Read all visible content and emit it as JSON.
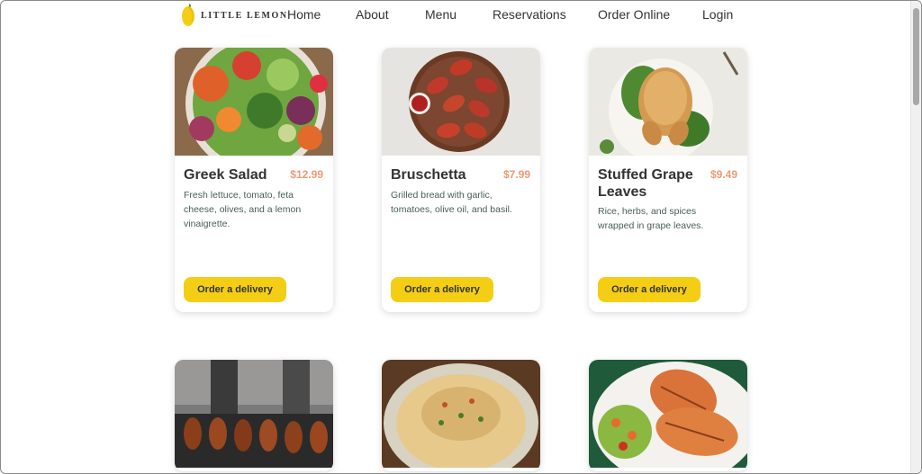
{
  "brand": {
    "name": "LITTLE LEMON"
  },
  "nav": {
    "items": [
      {
        "label": "Home"
      },
      {
        "label": "About"
      },
      {
        "label": "Menu"
      },
      {
        "label": "Reservations"
      },
      {
        "label": "Order Online"
      },
      {
        "label": "Login"
      }
    ]
  },
  "menu": {
    "cards": [
      {
        "title": "Greek Salad",
        "price": "$12.99",
        "description": "Fresh lettuce, tomato, feta cheese, olives, and a lemon vinaigrette.",
        "button": "Order a delivery",
        "image": "greek-salad-photo"
      },
      {
        "title": "Bruschetta",
        "price": "$7.99",
        "description": "Grilled bread with garlic, tomatoes, olive oil, and basil.",
        "button": "Order a delivery",
        "image": "bruschetta-photo"
      },
      {
        "title": "Stuffed Grape Leaves",
        "price": "$9.49",
        "description": "Rice, herbs, and spices wrapped in grape leaves.",
        "button": "Order a delivery",
        "image": "roast-chicken-photo"
      }
    ],
    "bottom_cards": [
      {
        "image": "grilled-skewers-photo"
      },
      {
        "image": "hummus-photo"
      },
      {
        "image": "grilled-chicken-photo"
      }
    ]
  },
  "colors": {
    "primary_yellow": "#f4ce14",
    "price_salmon": "#ee9972",
    "text_dark": "#333333",
    "text_green": "#495e57"
  }
}
